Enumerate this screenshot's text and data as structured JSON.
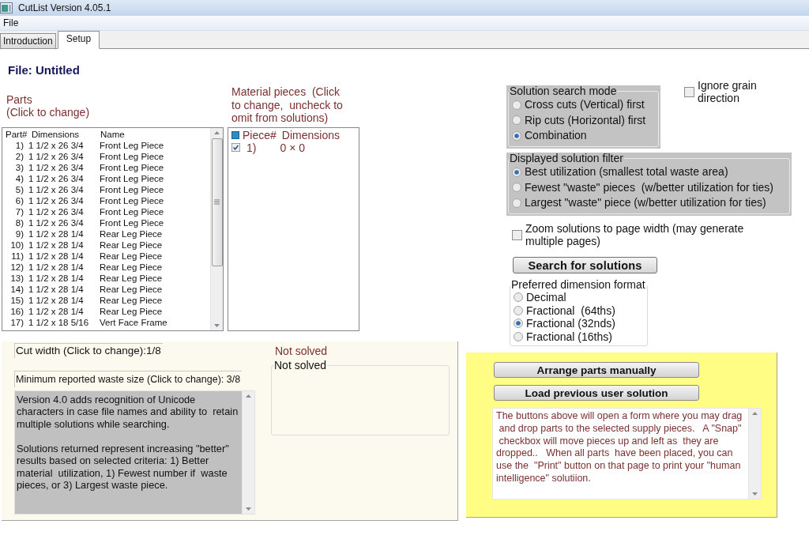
{
  "window": {
    "title": "CutList Version 4.05.1"
  },
  "menu": [
    {
      "label": "File"
    }
  ],
  "tabs": [
    {
      "label": "Introduction",
      "selected": false
    },
    {
      "label": "Setup",
      "selected": true
    }
  ],
  "file_title": "File: Untitled",
  "parts": {
    "label": "Parts\n(Click to change)",
    "columns": [
      "Part#",
      "Dimensions",
      "Name"
    ],
    "rows": [
      {
        "number": "1)",
        "dimensions": "1 1/2 x 26 3/4",
        "name": "Front Leg Piece"
      },
      {
        "number": "2)",
        "dimensions": "1 1/2 x 26 3/4",
        "name": "Front Leg Piece"
      },
      {
        "number": "3)",
        "dimensions": "1 1/2 x 26 3/4",
        "name": "Front Leg Piece"
      },
      {
        "number": "4)",
        "dimensions": "1 1/2 x 26 3/4",
        "name": "Front Leg Piece"
      },
      {
        "number": "5)",
        "dimensions": "1 1/2 x 26 3/4",
        "name": "Front Leg Piece"
      },
      {
        "number": "6)",
        "dimensions": "1 1/2 x 26 3/4",
        "name": "Front Leg Piece"
      },
      {
        "number": "7)",
        "dimensions": "1 1/2 x 26 3/4",
        "name": "Front Leg Piece"
      },
      {
        "number": "8)",
        "dimensions": "1 1/2 x 26 3/4",
        "name": "Front Leg Piece"
      },
      {
        "number": "9)",
        "dimensions": "1 1/2 x 28 1/4",
        "name": "Rear Leg Piece"
      },
      {
        "number": "10)",
        "dimensions": "1 1/2 x 28 1/4",
        "name": "Rear Leg Piece"
      },
      {
        "number": "11)",
        "dimensions": "1 1/2 x 28 1/4",
        "name": "Rear Leg Piece"
      },
      {
        "number": "12)",
        "dimensions": "1 1/2 x 28 1/4",
        "name": "Rear Leg Piece"
      },
      {
        "number": "13)",
        "dimensions": "1 1/2 x 28 1/4",
        "name": "Rear Leg Piece"
      },
      {
        "number": "14)",
        "dimensions": "1 1/2 x 28 1/4",
        "name": "Rear Leg Piece"
      },
      {
        "number": "15)",
        "dimensions": "1 1/2 x 28 1/4",
        "name": "Rear Leg Piece"
      },
      {
        "number": "16)",
        "dimensions": "1 1/2 x 28 1/4",
        "name": "Rear Leg Piece"
      },
      {
        "number": "17)",
        "dimensions": "1 1/2 x 18 5/16",
        "name": "Vert Face Frame"
      }
    ]
  },
  "material": {
    "label": "Material pieces  (Click\nto change,  uncheck to\nomit from solutions)",
    "columns": [
      "Piece#",
      "Dimensions"
    ],
    "rows": [
      {
        "number": "1)",
        "dimensions": "0 × 0",
        "checked": true
      }
    ]
  },
  "search_mode": {
    "title": "Solution search mode",
    "options": [
      {
        "label": "Cross cuts (Vertical) first",
        "selected": false
      },
      {
        "label": "Rip cuts (Horizontal) first",
        "selected": false
      },
      {
        "label": "Combination",
        "selected": true
      }
    ]
  },
  "ignore_grain": {
    "label": "Ignore grain\ndirection",
    "checked": false
  },
  "solution_filter": {
    "title": "Displayed solution filter",
    "options": [
      {
        "label": "Best utilization (smallest total waste area)",
        "selected": true
      },
      {
        "label": "Fewest \"waste\" pieces  (w/better utilization for ties)",
        "selected": false
      },
      {
        "label": "Largest \"waste\" piece (w/better utilization for ties)",
        "selected": false
      }
    ]
  },
  "zoom_to_width": {
    "label": "Zoom solutions to page width (may generate\nmultiple pages)",
    "checked": false
  },
  "search_button": {
    "label": "Search for solutions"
  },
  "dimension_format": {
    "title": "Preferred dimension format",
    "options": [
      {
        "label": "Decimal",
        "selected": false
      },
      {
        "label": "Fractional  (64ths)",
        "selected": false
      },
      {
        "label": "Fractional (32nds)",
        "selected": true
      },
      {
        "label": "Fractional (16ths)",
        "selected": false
      }
    ]
  },
  "cut_width": "Cut width (Click to change):1/8",
  "min_waste": "Minimum reported waste size (Click to change): 3/8",
  "version_notes": "Version 4.0 adds recognition of Unicode characters in case file names and ability to  retain multiple solutions while searching.\n\nSolutions returned represent increasing \"better\" results based on selected criteria: 1) Better material  utilization, 1) Fewest number if  waste pieces, or 3) Largest waste piece.",
  "solve_status": {
    "label": "Not solved",
    "frame_title": "Not solved"
  },
  "manual": {
    "buttons": [
      {
        "label": "Arrange parts manually"
      },
      {
        "label": "Load previous user solution"
      }
    ],
    "notes": "The buttons above will open a form where you may drag  and drop parts to the selected supply pieces.   A \"Snap\"  checkbox will move pieces up and left as  they are dropped..   When all parts  have been placed, you can use the  \"Print\" button on that page to print your \"human intelligence\" solutiion."
  }
}
